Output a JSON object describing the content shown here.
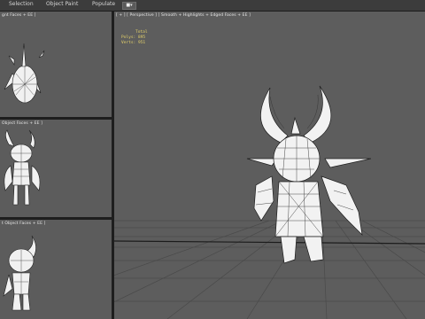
{
  "menu": {
    "items": [
      "Selection",
      "Object Paint",
      "Populate"
    ],
    "dropdown_label": "■▾"
  },
  "viewports": {
    "top_left": {
      "label": "gnt Faces + EE ]"
    },
    "mid_left": {
      "label": "Object Faces + EE ]"
    },
    "bottom_left": {
      "label": "t Object Faces + EE ]"
    },
    "main": {
      "label": "[ + ] [ Perspective ] [ Smooth + Highlights + Edged Faces + EE ]",
      "stats": {
        "header": "Total",
        "polys_label": "Polys:",
        "polys_value": "895",
        "verts_label": "Verts:",
        "verts_value": "951"
      }
    }
  },
  "colors": {
    "viewport_bg": "#5c5c5c",
    "divider": "#1e1e1e",
    "mesh_fill": "#f2f2f2",
    "mesh_edge": "#222222",
    "stats_text": "#e6d36a"
  }
}
